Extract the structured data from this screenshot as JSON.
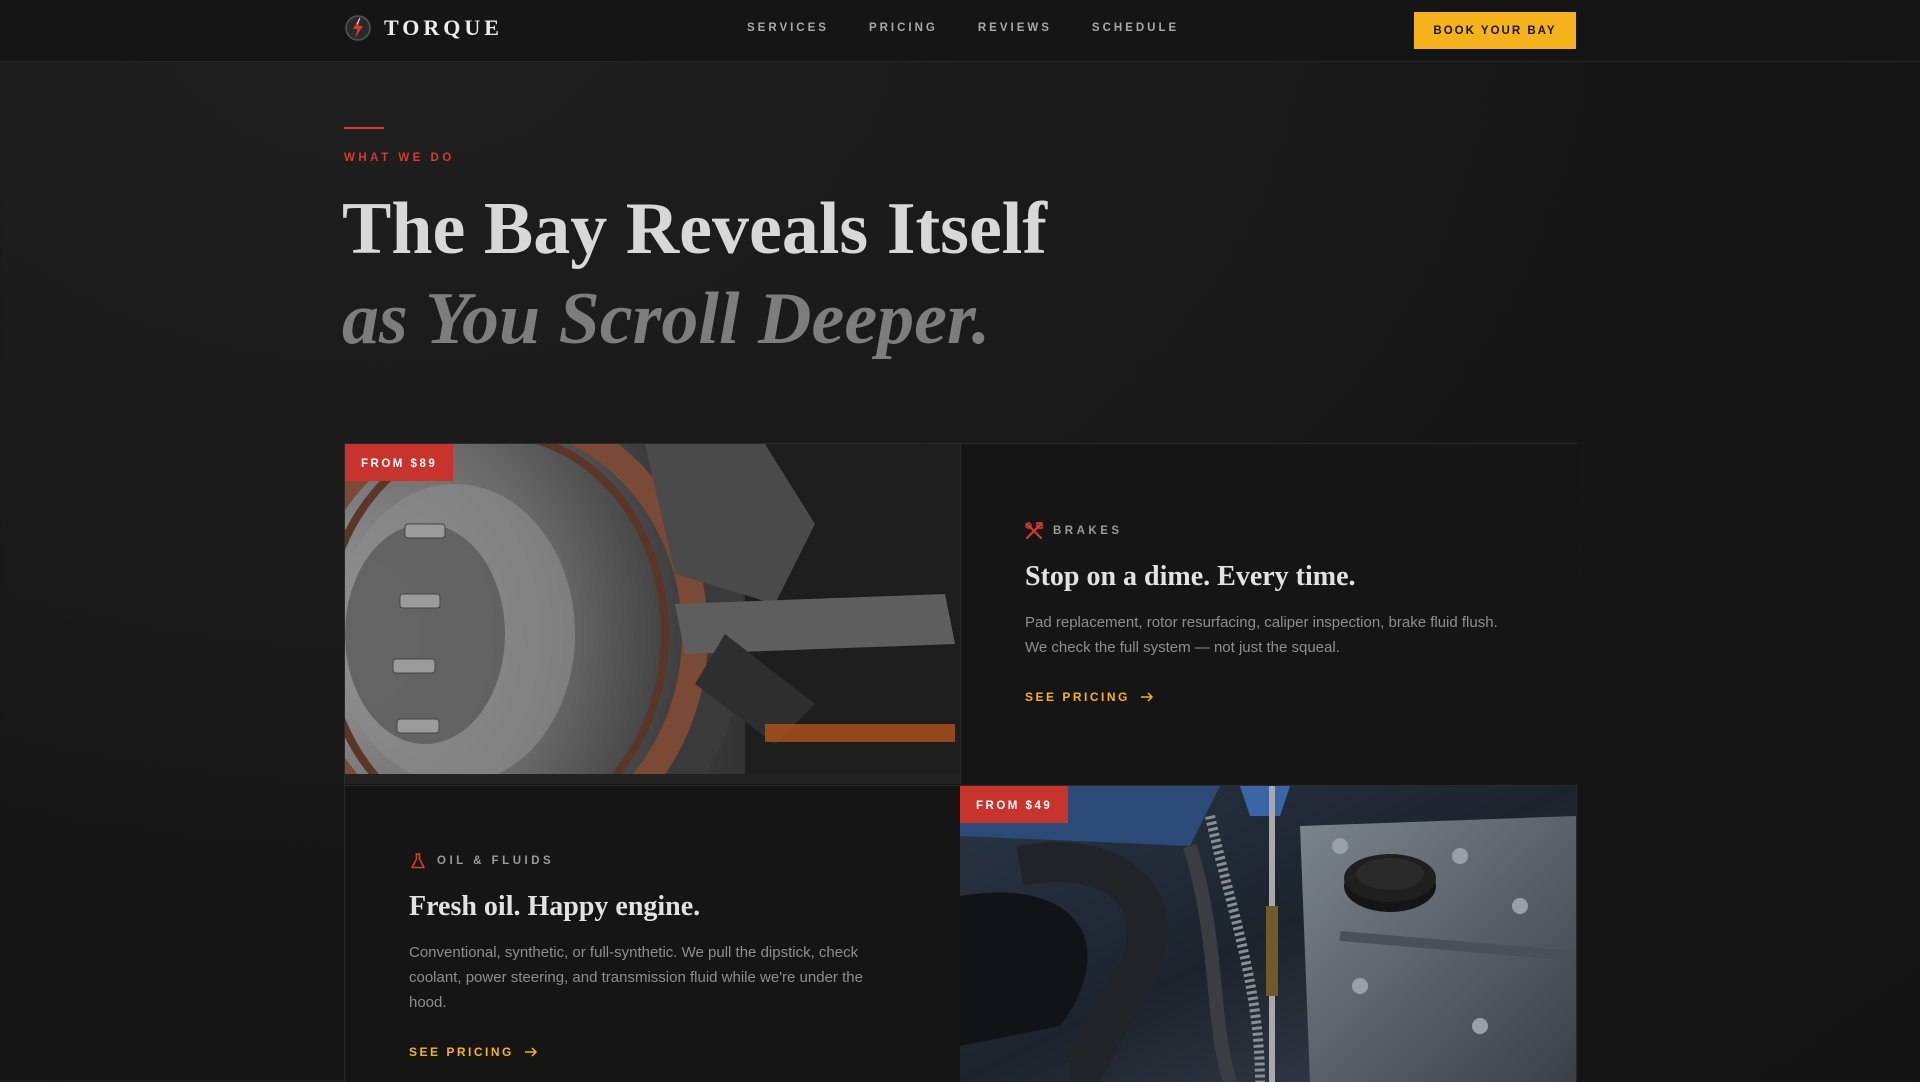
{
  "nav": {
    "brand": "TORQUE",
    "links": [
      "SERVICES",
      "PRICING",
      "REVIEWS",
      "SCHEDULE"
    ],
    "cta": "BOOK YOUR BAY"
  },
  "hero": {
    "eyebrow": "WHAT WE DO",
    "title": "The Bay Reveals Itself",
    "subtitle": "as You Scroll Deeper."
  },
  "services": [
    {
      "price": "FROM $89",
      "category": "BRAKES",
      "icon": "tools-icon",
      "title": "Stop on a dime. Every time.",
      "description": "Pad replacement, rotor resurfacing, caliper inspection, brake fluid flush. We check the full system — not just the squeal.",
      "link": "SEE PRICING"
    },
    {
      "price": "FROM $49",
      "category": "OIL & FLUIDS",
      "icon": "flask-icon",
      "title": "Fresh oil. Happy engine.",
      "description": "Conventional, synthetic, or full-synthetic. We pull the dipstick, check coolant, power steering, and transmission fluid while we're under the hood.",
      "link": "SEE PRICING"
    }
  ],
  "colors": {
    "accent": "#f5b21a",
    "brand_red": "#c8332b",
    "background": "#171717"
  }
}
